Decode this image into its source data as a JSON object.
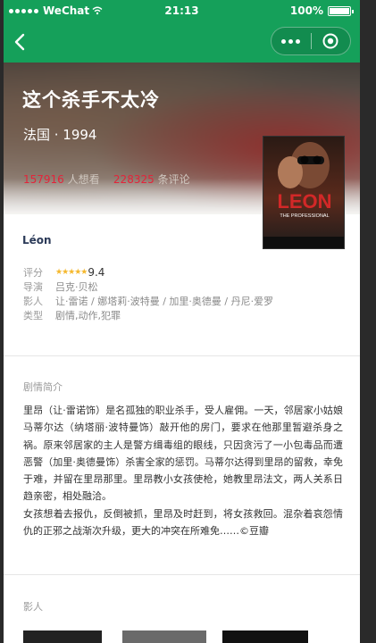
{
  "status_bar": {
    "carrier": "WeChat",
    "time": "21:13",
    "battery": "100%"
  },
  "nav": {
    "back_icon": "back-chevron-icon",
    "more_icon": "more-dots-icon",
    "close_icon": "target-close-icon"
  },
  "movie": {
    "title": "这个杀手不太冷",
    "meta": "法国 · 1994",
    "wish_count": "157916",
    "wish_label": "人想看",
    "collect_count": "228325",
    "collect_label": "条评论",
    "original_title": "Léon",
    "poster_title": "LEON",
    "poster_subtitle": "THE PROFESSIONAL"
  },
  "info": {
    "rating_label": "评分",
    "rating_stars": 5,
    "rating_value": "9.4",
    "director_label": "导演",
    "director": "吕克·贝松",
    "cast_label": "影人",
    "cast": "让·雷诺 / 娜塔莉·波特曼 / 加里·奥德曼 / 丹尼·爱罗",
    "genre_label": "类型",
    "genre": "剧情,动作,犯罪"
  },
  "synopsis": {
    "heading": "剧情简介",
    "text_p1": "里昂（让·雷诺饰）是名孤独的职业杀手，受人雇佣。一天，邻居家小姑娘马蒂尔达（纳塔丽·波特曼饰）敲开他的房门，要求在他那里暂避杀身之祸。原来邻居家的主人是警方缉毒组的眼线，只因贪污了一小包毒品而遭恶警（加里·奥德曼饰）杀害全家的惩罚。马蒂尔达得到里昂的留救，幸免于难，并留在里昂那里。里昂教小女孩使枪，她教里昂法文，两人关系日趋亲密，相处融洽。",
    "text_p2": "女孩想着去报仇，反倒被抓，里昂及时赶到，将女孩救回。混杂着哀怨情仇的正邪之战渐次升级，更大的冲突在所难免……©豆瓣"
  },
  "cast_section": {
    "heading": "影人"
  },
  "colors": {
    "nav_green": "#15a05a",
    "count_red": "#e3243a",
    "star_yellow": "#f5b82e",
    "english_title": "#2b3a58"
  }
}
